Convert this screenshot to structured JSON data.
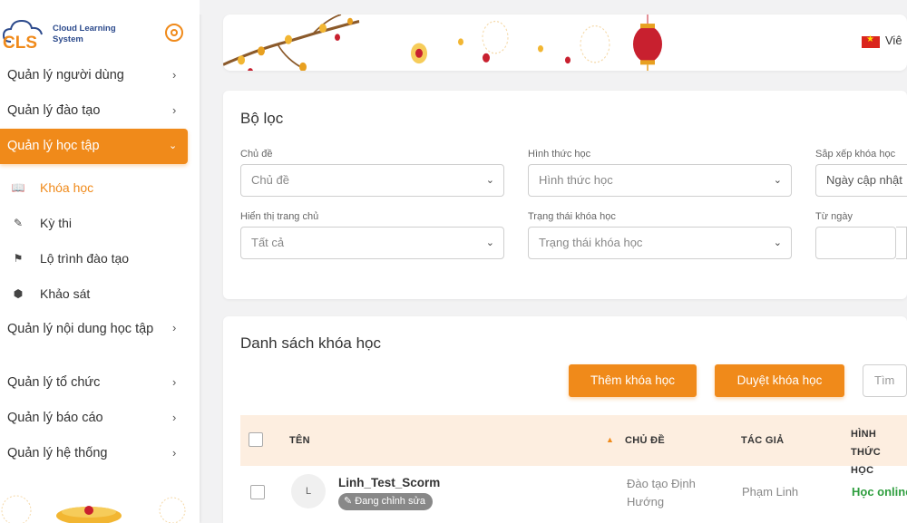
{
  "brand": {
    "logo_letters": "CLS",
    "name_line1": "Cloud Learning",
    "name_line2": "System"
  },
  "sidebar": {
    "items": [
      {
        "label": "Quản lý người dùng",
        "chevron": "›"
      },
      {
        "label": "Quản lý đào tạo",
        "chevron": "›"
      },
      {
        "label": "Quản lý học tập",
        "chevron": "⌄",
        "active": true
      },
      {
        "label": "Quản lý nội dung học tập",
        "chevron": "›"
      },
      {
        "label": "Quản lý tổ chức",
        "chevron": "›"
      },
      {
        "label": "Quản lý báo cáo",
        "chevron": "›"
      },
      {
        "label": "Quản lý hệ thống",
        "chevron": "›"
      }
    ],
    "sub_items": [
      {
        "label": "Khóa học",
        "icon": "book-icon",
        "glyph": "📖",
        "current": true
      },
      {
        "label": "Kỳ thi",
        "icon": "pencil-icon",
        "glyph": "✎"
      },
      {
        "label": "Lộ trình đào tạo",
        "icon": "route-icon",
        "glyph": "⚑"
      },
      {
        "label": "Khảo sát",
        "icon": "cube-icon",
        "glyph": "⬢"
      }
    ]
  },
  "header": {
    "language_label": "Viê",
    "flag": "vietnam-flag-icon"
  },
  "filter": {
    "title": "Bộ lọc",
    "fields": [
      {
        "label": "Chủ đề",
        "value": "Chủ đề"
      },
      {
        "label": "Hình thức học",
        "value": "Hình thức học"
      },
      {
        "label": "Sắp xếp khóa học",
        "value": "Ngày cập nhật"
      },
      {
        "label": "Hiển thị trang chủ",
        "value": "Tất cả"
      },
      {
        "label": "Trạng thái khóa học",
        "value": "Trạng thái khóa học"
      },
      {
        "label": "Từ ngày",
        "value": ""
      }
    ],
    "caret": "⌄"
  },
  "course_list": {
    "title": "Danh sách khóa học",
    "add_button": "Thêm khóa học",
    "approve_button": "Duyệt khóa học",
    "search_placeholder": "Tìm",
    "columns": {
      "name": "TÊN",
      "topic": "CHỦ ĐỀ",
      "author": "TÁC GIẢ",
      "format_line1": "HÌNH THỨC",
      "format_line2": "HỌC"
    },
    "sort_glyph": "▲",
    "rows": [
      {
        "avatar": "L",
        "name": "Linh_Test_Scorm",
        "status": "✎ Đang chỉnh sửa",
        "topic_line1": "Đào tạo Định",
        "topic_line2": "Hướng",
        "author": "Phạm Linh",
        "format": "Học online"
      }
    ]
  },
  "colors": {
    "accent": "#f08a1a",
    "header_row": "#fdeee0",
    "online_green": "#2e9e3e",
    "brand_blue": "#2c4a8c"
  }
}
